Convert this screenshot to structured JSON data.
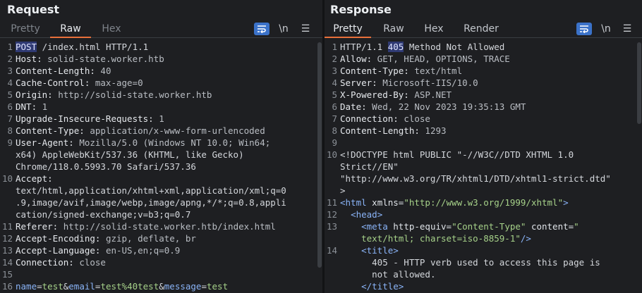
{
  "request": {
    "title": "Request",
    "tabs": [
      {
        "label": "Pretty",
        "active": false
      },
      {
        "label": "Raw",
        "active": true
      },
      {
        "label": "Hex",
        "active": false
      }
    ],
    "newline_label": "\\n",
    "lines": [
      {
        "n": "1",
        "method": "POST",
        "rest": " /index.html HTTP/1.1"
      },
      {
        "n": "2",
        "name": "Host:",
        "value": " solid-state.worker.htb"
      },
      {
        "n": "3",
        "name": "Content-Length:",
        "value": " 40"
      },
      {
        "n": "4",
        "name": "Cache-Control:",
        "value": " max-age=0"
      },
      {
        "n": "5",
        "name": "Origin:",
        "value": " http://solid-state.worker.htb"
      },
      {
        "n": "6",
        "name": "DNT:",
        "value": " 1"
      },
      {
        "n": "7",
        "name": "Upgrade-Insecure-Requests:",
        "value": " 1"
      },
      {
        "n": "8",
        "name": "Content-Type:",
        "value": " application/x-www-form-urlencoded"
      },
      {
        "n": "9",
        "name": "User-Agent:",
        "value": " Mozilla/5.0 (Windows NT 10.0; Win64;"
      },
      {
        "n": "",
        "value": "x64) AppleWebKit/537.36 (KHTML, like Gecko)"
      },
      {
        "n": "",
        "value": "Chrome/118.0.5993.70 Safari/537.36"
      },
      {
        "n": "10",
        "name": "Accept:",
        "value": ""
      },
      {
        "n": "",
        "value": "text/html,application/xhtml+xml,application/xml;q=0"
      },
      {
        "n": "",
        "value": ".9,image/avif,image/webp,image/apng,*/*;q=0.8,appli"
      },
      {
        "n": "",
        "value": "cation/signed-exchange;v=b3;q=0.7"
      },
      {
        "n": "11",
        "name": "Referer:",
        "value": " http://solid-state.worker.htb/index.html"
      },
      {
        "n": "12",
        "name": "Accept-Encoding:",
        "value": " gzip, deflate, br"
      },
      {
        "n": "13",
        "name": "Accept-Language:",
        "value": " en-US,en;q=0.9"
      },
      {
        "n": "14",
        "name": "Connection:",
        "value": " close"
      },
      {
        "n": "15",
        "value": ""
      },
      {
        "n": "16",
        "body": [
          {
            "k": "name",
            "v": "test"
          },
          {
            "k": "email",
            "v": "test%40test"
          },
          {
            "k": "message",
            "v": "test"
          }
        ]
      }
    ]
  },
  "response": {
    "title": "Response",
    "tabs": [
      {
        "label": "Pretty",
        "active": true
      },
      {
        "label": "Raw",
        "active": false
      },
      {
        "label": "Hex",
        "active": false
      },
      {
        "label": "Render",
        "active": false
      }
    ],
    "newline_label": "\\n",
    "lines": [
      {
        "n": "1",
        "pre": "HTTP/1.1 ",
        "code": "405",
        "post": " Method Not Allowed"
      },
      {
        "n": "2",
        "name": "Allow:",
        "value": " GET, HEAD, OPTIONS, TRACE"
      },
      {
        "n": "3",
        "name": "Content-Type:",
        "value": " text/html"
      },
      {
        "n": "4",
        "name": "Server:",
        "value": " Microsoft-IIS/10.0"
      },
      {
        "n": "5",
        "name": "X-Powered-By:",
        "value": " ASP.NET"
      },
      {
        "n": "6",
        "name": "Date:",
        "value": " Wed, 22 Nov 2023 19:35:13 GMT"
      },
      {
        "n": "7",
        "name": "Connection:",
        "value": " close"
      },
      {
        "n": "8",
        "name": "Content-Length:",
        "value": " 1293"
      },
      {
        "n": "9",
        "value": ""
      },
      {
        "n": "10",
        "value": "<!DOCTYPE html PUBLIC \"-//W3C//DTD XHTML 1.0"
      },
      {
        "n": "",
        "value": "Strict//EN\""
      },
      {
        "n": "",
        "value": "\"http://www.w3.org/TR/xhtml1/DTD/xhtml1-strict.dtd\""
      },
      {
        "n": "",
        "value": ">"
      },
      {
        "n": "11",
        "tag_open": "<html",
        "attr": " xmlns=",
        "str": "\"http://www.w3.org/1999/xhtml\"",
        "tag_close": ">"
      },
      {
        "n": "12",
        "indent": "  ",
        "tag_open": "<head>"
      },
      {
        "n": "13",
        "indent": "    ",
        "tag_open": "<meta",
        "attr": " http-equiv=",
        "str": "\"Content-Type\"",
        "attr2": " content=",
        "str2": "\""
      },
      {
        "n": "",
        "indent": "    ",
        "str": "text/html; charset=iso-8859-1\"",
        "tag_close": "/>"
      },
      {
        "n": "14",
        "indent": "    ",
        "tag_open": "<title>"
      },
      {
        "n": "",
        "indent": "      ",
        "value": "405 - HTTP verb used to access this page is"
      },
      {
        "n": "",
        "indent": "      ",
        "value": "not allowed."
      },
      {
        "n": "",
        "indent": "    ",
        "tag_open": "</title>"
      }
    ]
  }
}
